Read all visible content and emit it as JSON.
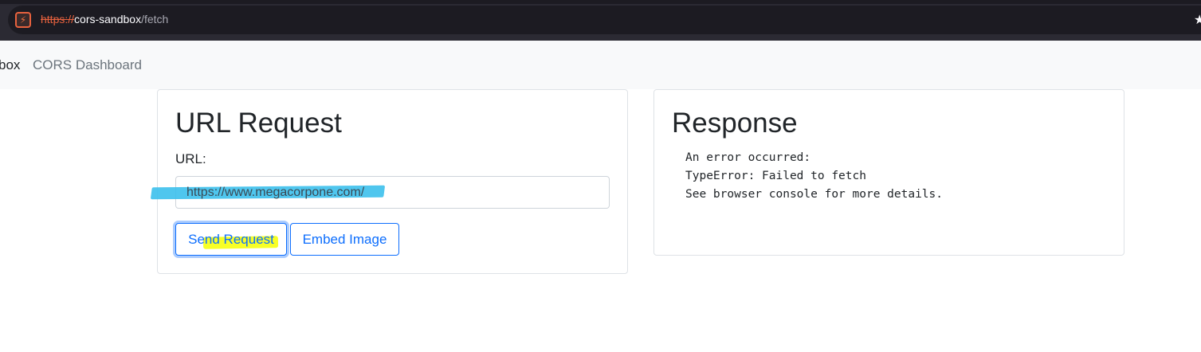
{
  "browser": {
    "url_protocol": "https://",
    "url_host": "cors-sandbox",
    "url_path": "/fetch",
    "site_icon": "sandbox-icon",
    "bookmark_icon": "star-icon"
  },
  "navbar": {
    "brand": "box",
    "link": "CORS Dashboard"
  },
  "request_card": {
    "title": "URL Request",
    "url_label": "URL:",
    "url_value": "https://www.megacorpone.com/",
    "send_button": "Send Request",
    "embed_button": "Embed Image"
  },
  "response_card": {
    "title": "Response",
    "lines": [
      "An error occurred:",
      "TypeError: Failed to fetch",
      "See browser console for more details."
    ]
  },
  "colors": {
    "primary": "#0d6efd",
    "highlight_blue": "#3cc0ec",
    "highlight_yellow": "#f6ff00",
    "protocol_red": "#e8623e"
  }
}
